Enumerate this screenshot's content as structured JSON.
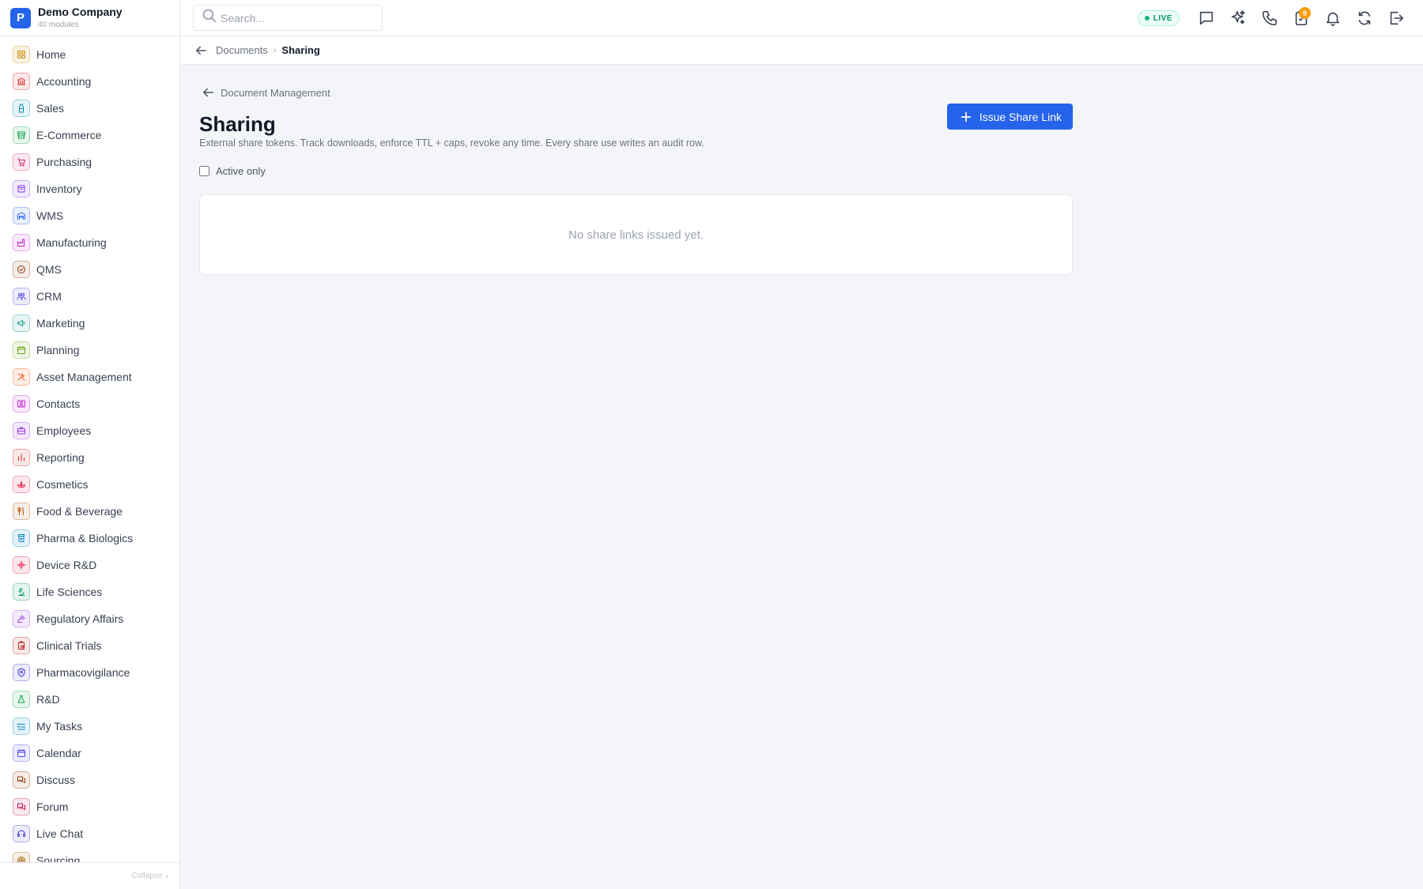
{
  "company": {
    "logo_letter": "P",
    "name": "Demo Company",
    "modules": "40 modules"
  },
  "sidebar": {
    "items": [
      {
        "label": "Home",
        "icon": "grid-icon",
        "color": "#ca8a04"
      },
      {
        "label": "Accounting",
        "icon": "bank-icon",
        "color": "#dc2626"
      },
      {
        "label": "Sales",
        "icon": "bottle-icon",
        "color": "#0891b2"
      },
      {
        "label": "E-Commerce",
        "icon": "storefront-icon",
        "color": "#16a34a"
      },
      {
        "label": "Purchasing",
        "icon": "cart-icon",
        "color": "#db2777"
      },
      {
        "label": "Inventory",
        "icon": "box-icon",
        "color": "#7c3aed"
      },
      {
        "label": "WMS",
        "icon": "warehouse-icon",
        "color": "#2563eb"
      },
      {
        "label": "Manufacturing",
        "icon": "factory-icon",
        "color": "#c026d3"
      },
      {
        "label": "QMS",
        "icon": "badge-check-icon",
        "color": "#92400e"
      },
      {
        "label": "CRM",
        "icon": "users-icon",
        "color": "#4f46e5"
      },
      {
        "label": "Marketing",
        "icon": "megaphone-icon",
        "color": "#0d9488"
      },
      {
        "label": "Planning",
        "icon": "calendar-icon",
        "color": "#65a30d"
      },
      {
        "label": "Asset Management",
        "icon": "tools-icon",
        "color": "#ea580c"
      },
      {
        "label": "Contacts",
        "icon": "contact-card-icon",
        "color": "#c026d3"
      },
      {
        "label": "Employees",
        "icon": "briefcase-icon",
        "color": "#9333ea"
      },
      {
        "label": "Reporting",
        "icon": "bar-chart-icon",
        "color": "#dc2626"
      },
      {
        "label": "Cosmetics",
        "icon": "lotus-icon",
        "color": "#e11d48"
      },
      {
        "label": "Food & Beverage",
        "icon": "utensils-icon",
        "color": "#b45309"
      },
      {
        "label": "Pharma & Biologics",
        "icon": "pill-bottle-icon",
        "color": "#0284c7"
      },
      {
        "label": "Device R&D",
        "icon": "chip-icon",
        "color": "#e11d48"
      },
      {
        "label": "Life Sciences",
        "icon": "microscope-icon",
        "color": "#059669"
      },
      {
        "label": "Regulatory Affairs",
        "icon": "gavel-icon",
        "color": "#9333ea"
      },
      {
        "label": "Clinical Trials",
        "icon": "clipboard-icon",
        "color": "#b91c1c"
      },
      {
        "label": "Pharmacovigilance",
        "icon": "shield-icon",
        "color": "#4338ca"
      },
      {
        "label": "R&D",
        "icon": "flask-icon",
        "color": "#16a34a"
      },
      {
        "label": "My Tasks",
        "icon": "checklist-icon",
        "color": "#0284c7"
      },
      {
        "label": "Calendar",
        "icon": "calendar-icon",
        "color": "#4f46e5"
      },
      {
        "label": "Discuss",
        "icon": "chat-bubbles-icon",
        "color": "#92400e"
      },
      {
        "label": "Forum",
        "icon": "chat-bubbles-icon",
        "color": "#be185d"
      },
      {
        "label": "Live Chat",
        "icon": "headset-icon",
        "color": "#4338ca"
      },
      {
        "label": "Sourcing",
        "icon": "target-icon",
        "color": "#a16207"
      }
    ],
    "collapse_label": "Collapse"
  },
  "topbar": {
    "search_placeholder": "Search...",
    "live_label": "LIVE",
    "notification_count": "9",
    "icons": [
      "message-icon",
      "sparkles-icon",
      "phone-icon",
      "approval-icon",
      "bell-icon",
      "sync-icon",
      "logout-icon"
    ]
  },
  "breadcrumb": {
    "parent": "Documents",
    "current": "Sharing"
  },
  "page": {
    "back_label": "Document Management",
    "title": "Sharing",
    "subtitle": "External share tokens. Track downloads, enforce TTL + caps, revoke any time. Every share use writes an audit row.",
    "issue_button_label": "Issue Share Link",
    "filter_label": "Active only",
    "filter_checked": false,
    "empty_message": "No share links issued yet."
  },
  "colors": {
    "accent": "#2563eb",
    "live": "#10b981",
    "badge": "#f59e0b"
  }
}
